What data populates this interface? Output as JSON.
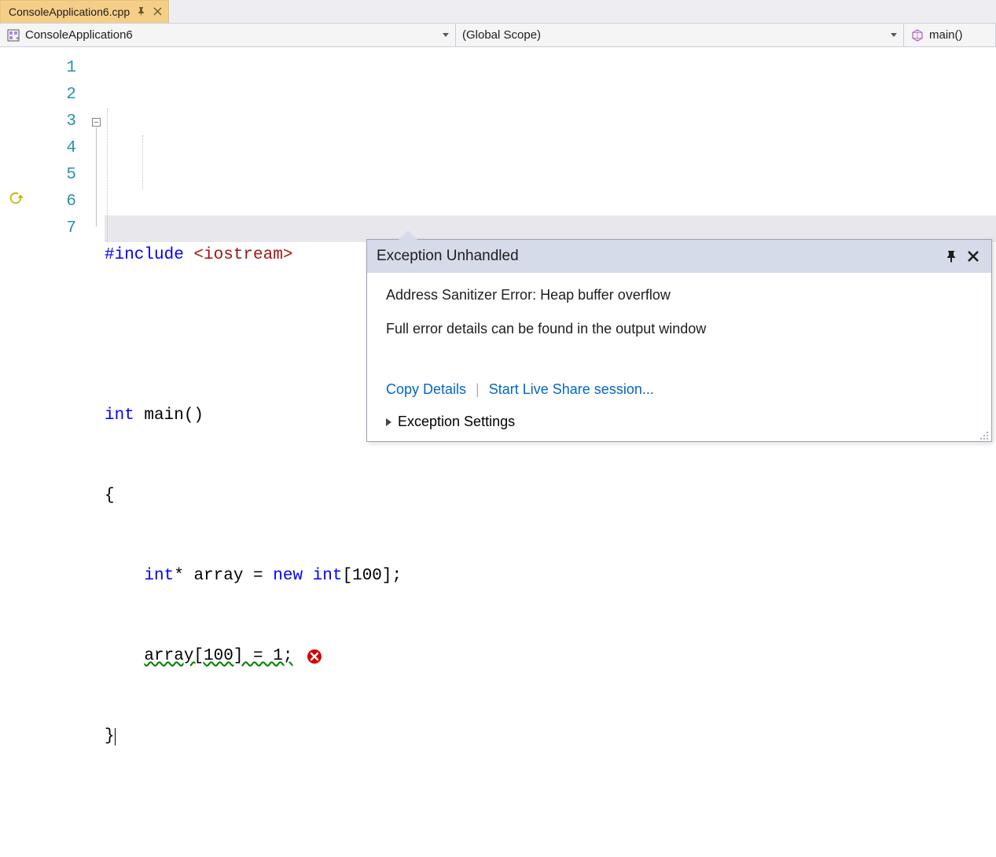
{
  "tab": {
    "filename": "ConsoleApplication6.cpp",
    "pinned": true
  },
  "navbar": {
    "project": "ConsoleApplication6",
    "scope": "(Global Scope)",
    "function": "main()"
  },
  "code": {
    "line_numbers": [
      "1",
      "2",
      "3",
      "4",
      "5",
      "6",
      "7"
    ],
    "current_line": 7,
    "lines": {
      "l1_include": "#include ",
      "l1_lib": "<iostream>",
      "l3_kw": "int",
      "l3_rest": " main()",
      "l4": "{",
      "l5_ws": "    ",
      "l5_kw1": "int",
      "l5_mid": "* array = ",
      "l5_kw2": "new",
      "l5_mid2": " ",
      "l5_kw3": "int",
      "l5_end": "[100];",
      "l6_ws": "    ",
      "l6_text": "array[100] = 1;",
      "l7": "}"
    }
  },
  "exception": {
    "title": "Exception Unhandled",
    "message1": "Address Sanitizer Error: Heap buffer overflow",
    "message2": "Full error details can be found in the output window",
    "copy_details": "Copy Details",
    "live_share": "Start Live Share session...",
    "settings": "Exception Settings"
  }
}
